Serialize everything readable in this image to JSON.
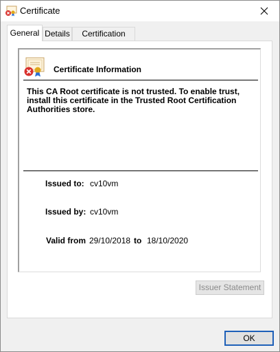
{
  "window": {
    "title": "Certificate"
  },
  "tabs": [
    {
      "label": "General",
      "active": true
    },
    {
      "label": "Details",
      "active": false
    },
    {
      "label": "Certification Path",
      "active": false
    }
  ],
  "general": {
    "heading": "Certificate Information",
    "message": "This CA Root certificate is not trusted. To enable trust, install this certificate in the Trusted Root Certification Authorities store.",
    "issued_to_label": "Issued to:",
    "issued_to_value": "cv10vm",
    "issued_by_label": "Issued by:",
    "issued_by_value": "cv10vm",
    "valid_from_label": "Valid from",
    "valid_from_value": "29/10/2018",
    "valid_to_label": "to",
    "valid_to_value": "18/10/2020",
    "issuer_statement_label": "Issuer Statement"
  },
  "footer": {
    "ok_label": "OK"
  },
  "colors": {
    "accent": "#1d5fb8",
    "error_red": "#d9302c",
    "seal_gold": "#e0a81b"
  }
}
